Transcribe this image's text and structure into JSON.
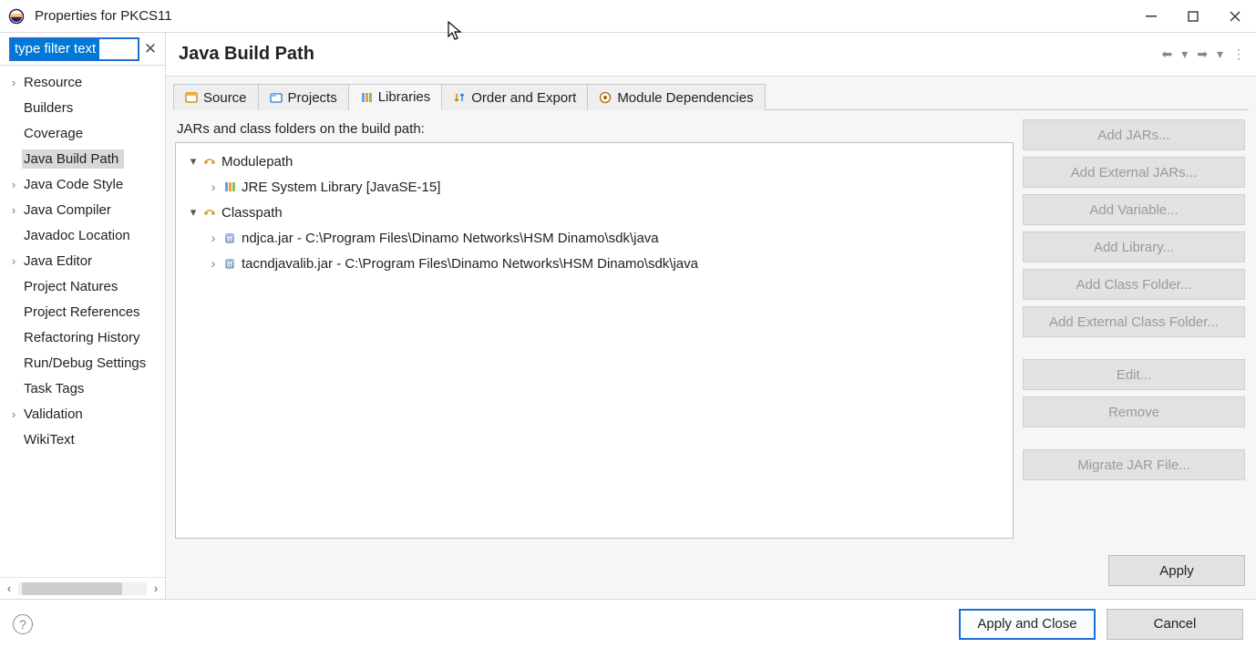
{
  "window": {
    "title": "Properties for PKCS11"
  },
  "filter": {
    "placeholder": "type filter text"
  },
  "navTree": [
    {
      "label": "Resource",
      "expandable": true
    },
    {
      "label": "Builders",
      "expandable": false
    },
    {
      "label": "Coverage",
      "expandable": false
    },
    {
      "label": "Java Build Path",
      "expandable": false,
      "selected": true
    },
    {
      "label": "Java Code Style",
      "expandable": true
    },
    {
      "label": "Java Compiler",
      "expandable": true
    },
    {
      "label": "Javadoc Location",
      "expandable": false
    },
    {
      "label": "Java Editor",
      "expandable": true
    },
    {
      "label": "Project Natures",
      "expandable": false
    },
    {
      "label": "Project References",
      "expandable": false
    },
    {
      "label": "Refactoring History",
      "expandable": false
    },
    {
      "label": "Run/Debug Settings",
      "expandable": false
    },
    {
      "label": "Task Tags",
      "expandable": false
    },
    {
      "label": "Validation",
      "expandable": true
    },
    {
      "label": "WikiText",
      "expandable": false
    }
  ],
  "page": {
    "title": "Java Build Path"
  },
  "tabs": [
    {
      "label": "Source"
    },
    {
      "label": "Projects"
    },
    {
      "label": "Libraries",
      "active": true
    },
    {
      "label": "Order and Export"
    },
    {
      "label": "Module Dependencies"
    }
  ],
  "buildPath": {
    "caption": "JARs and class folders on the build path:",
    "nodes": {
      "modulepath": {
        "label": "Modulepath",
        "children": [
          {
            "label": "JRE System Library [JavaSE-15]"
          }
        ]
      },
      "classpath": {
        "label": "Classpath",
        "children": [
          {
            "label": "ndjca.jar - C:\\Program Files\\Dinamo Networks\\HSM Dinamo\\sdk\\java"
          },
          {
            "label": "tacndjavalib.jar - C:\\Program Files\\Dinamo Networks\\HSM Dinamo\\sdk\\java"
          }
        ]
      }
    }
  },
  "buttons": {
    "addJars": "Add JARs...",
    "addExternalJars": "Add External JARs...",
    "addVariable": "Add Variable...",
    "addLibrary": "Add Library...",
    "addClassFolder": "Add Class Folder...",
    "addExternalClassFolder": "Add External Class Folder...",
    "edit": "Edit...",
    "remove": "Remove",
    "migrateJar": "Migrate JAR File...",
    "apply": "Apply",
    "applyClose": "Apply and Close",
    "cancel": "Cancel"
  }
}
